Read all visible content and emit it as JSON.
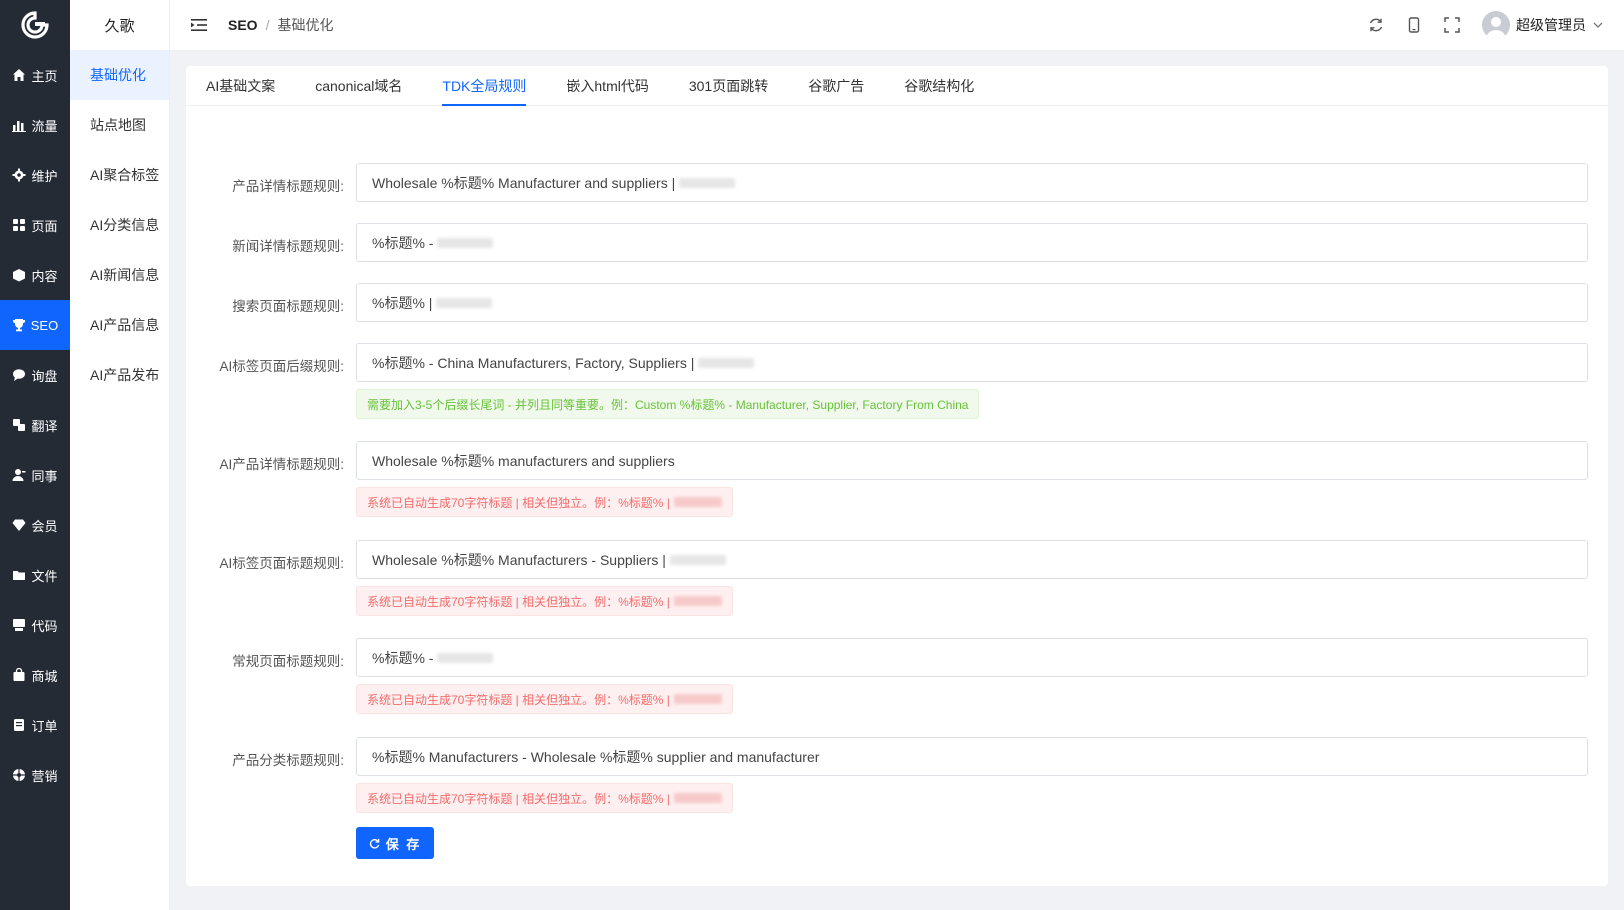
{
  "brand": {
    "logo": "g-logo-icon",
    "accent": "#1165ff",
    "sidebar_bg": "#252b35"
  },
  "rail": {
    "items": [
      {
        "label": "主页",
        "icon": "home-icon"
      },
      {
        "label": "流量",
        "icon": "bar-chart-icon"
      },
      {
        "label": "维护",
        "icon": "gear-icon"
      },
      {
        "label": "页面",
        "icon": "grid-icon"
      },
      {
        "label": "内容",
        "icon": "box-icon"
      },
      {
        "label": "SEO",
        "icon": "trophy-icon"
      },
      {
        "label": "询盘",
        "icon": "chat-icon"
      },
      {
        "label": "翻译",
        "icon": "translate-icon"
      },
      {
        "label": "同事",
        "icon": "user-icon"
      },
      {
        "label": "会员",
        "icon": "diamond-icon"
      },
      {
        "label": "文件",
        "icon": "folder-icon"
      },
      {
        "label": "代码",
        "icon": "code-icon"
      },
      {
        "label": "商城",
        "icon": "bag-icon"
      },
      {
        "label": "订单",
        "icon": "order-icon"
      },
      {
        "label": "营销",
        "icon": "marketing-icon"
      }
    ]
  },
  "submenu": {
    "title": "久歌",
    "items": [
      {
        "label": "基础优化"
      },
      {
        "label": "站点地图"
      },
      {
        "label": "AI聚合标签"
      },
      {
        "label": "AI分类信息"
      },
      {
        "label": "AI新闻信息"
      },
      {
        "label": "AI产品信息"
      },
      {
        "label": "AI产品发布"
      }
    ]
  },
  "header": {
    "breadcrumb_root": "SEO",
    "breadcrumb_sep": "/",
    "breadcrumb_current": "基础优化",
    "user_name": "超级管理员"
  },
  "tabs": [
    {
      "label": "AI基础文案"
    },
    {
      "label": "canonical域名"
    },
    {
      "label": "TDK全局规则"
    },
    {
      "label": "嵌入html代码"
    },
    {
      "label": "301页面跳转"
    },
    {
      "label": "谷歌广告"
    },
    {
      "label": "谷歌结构化"
    }
  ],
  "form": {
    "rows": [
      {
        "label": "产品详情标题规则:",
        "value": "Wholesale %标题% Manufacturer and suppliers |"
      },
      {
        "label": "新闻详情标题规则:",
        "value": "%标题% -"
      },
      {
        "label": "搜索页面标题规则:",
        "value": "%标题% |"
      },
      {
        "label": "AI标签页面后缀规则:",
        "value": "%标题% - China Manufacturers, Factory, Suppliers |",
        "hint": "需要加入3-5个后缀长尾词 - 并列且同等重要。例：Custom %标题% - Manufacturer, Supplier, Factory From China"
      },
      {
        "label": "AI产品详情标题规则:",
        "value": "Wholesale %标题% manufacturers and suppliers",
        "hint": "系统已自动生成70字符标题 | 相关但独立。例：%标题% |"
      },
      {
        "label": "AI标签页面标题规则:",
        "value": "Wholesale %标题%  Manufacturers - Suppliers |",
        "hint": "系统已自动生成70字符标题 | 相关但独立。例：%标题% |"
      },
      {
        "label": "常规页面标题规则:",
        "value": "%标题% -",
        "hint": "系统已自动生成70字符标题 | 相关但独立。例：%标题% |"
      },
      {
        "label": "产品分类标题规则:",
        "value": "%标题% Manufacturers - Wholesale %标题% supplier and manufacturer",
        "hint": "系统已自动生成70字符标题 | 相关但独立。例：%标题% |"
      }
    ],
    "save_label": "保 存"
  }
}
